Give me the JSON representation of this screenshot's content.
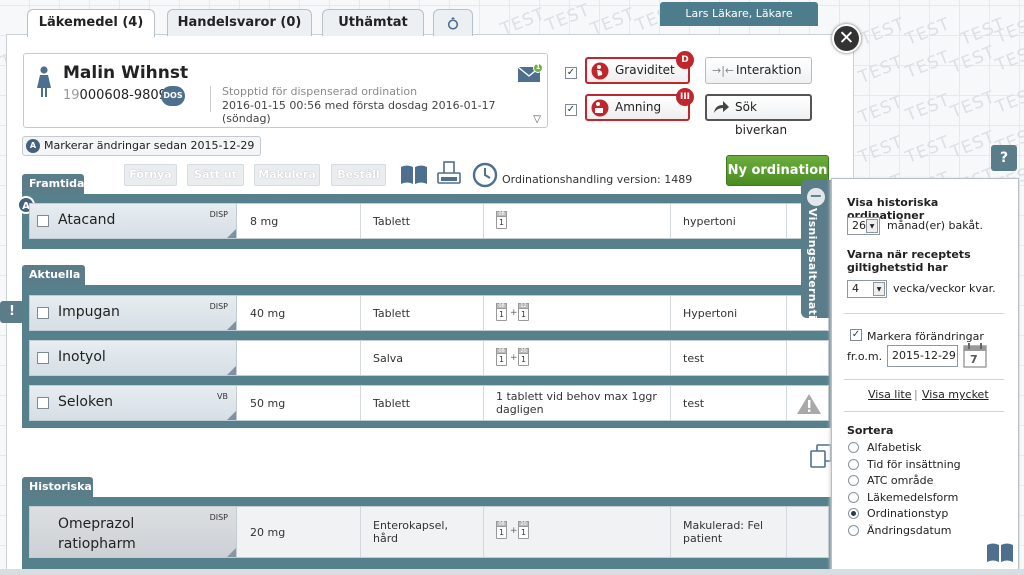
{
  "tabs": [
    {
      "label": "Läkemedel (4)"
    },
    {
      "label": "Handelsvaror (0)"
    },
    {
      "label": "Uthämtat"
    }
  ],
  "watermark": "TEST",
  "user": {
    "label": "Lars Läkare, Läkare"
  },
  "patient": {
    "name": "Malin Wihnst",
    "id_prefix": "19",
    "id_rest": "000608-9809",
    "dos_badge": "DOS",
    "stop_label": "Stopptid för dispenserad ordination",
    "stop_detail": "2016-01-15 00:56 med första dosdag 2016-01-17 (söndag)",
    "mail_badge": "1"
  },
  "flags": {
    "pregnancy": {
      "label": "Graviditet",
      "badge": "D",
      "checked": true
    },
    "breastfeeding": {
      "label": "Amning",
      "badge": "III",
      "checked": true
    }
  },
  "actions": {
    "interaction": "Interaktion",
    "side_effects": "Sök biverkan"
  },
  "changes": {
    "badge": "A",
    "label": "Markerar ändringar sedan 2015-12-29"
  },
  "toolbar": {
    "renew": "Förnya",
    "discontinue": "Sätt ut",
    "cancel": "Makulera",
    "order": "Beställ",
    "version": "Ordinationshandling version: 1489",
    "new_order": "Ny ordination"
  },
  "sections": {
    "future": "Framtida",
    "current": "Aktuella",
    "historical": "Historiska"
  },
  "rows": {
    "atacand": {
      "name": "Atacand",
      "tag": "DISP",
      "dose": "8 mg",
      "form": "Tablett",
      "boxes": [
        "1"
      ],
      "box_tops": [
        "08"
      ],
      "indication": "hypertoni",
      "marker": "A"
    },
    "impugan": {
      "name": "Impugan",
      "tag": "DISP",
      "dose": "40 mg",
      "form": "Tablett",
      "boxes": [
        "1",
        "1"
      ],
      "box_tops": [
        "08",
        "12"
      ],
      "indication": "Hypertoni"
    },
    "inotyol": {
      "name": "Inotyol",
      "tag": "",
      "dose": "",
      "form": "Salva",
      "boxes": [
        "1",
        "1"
      ],
      "box_tops": [
        "08",
        "20"
      ],
      "indication": "test"
    },
    "seloken": {
      "name": "Seloken",
      "tag": "VB",
      "dose": "50 mg",
      "form": "Tablett",
      "instruction": "1 tablett vid behov max 1ggr dagligen",
      "indication": "test"
    },
    "omeprazol": {
      "name": "Omeprazol ratiopharm",
      "tag": "DISP",
      "dose": "20 mg",
      "form": "Enterokapsel, hård",
      "boxes": [
        "1",
        "1"
      ],
      "box_tops": [
        "08",
        "20"
      ],
      "indication": "Makulerad: Fel patient"
    }
  },
  "side_tab": {
    "label": "Visningsalternativ",
    "help": "?"
  },
  "panel": {
    "history_title": "Visa historiska ordinationer",
    "history_value": "26",
    "history_suffix": "månad(er) bakåt.",
    "warn_title": "Varna när receptets giltighetstid har",
    "warn_value": "4",
    "warn_suffix": "vecka/veckor kvar.",
    "mark_label": "Markera förändringar",
    "from_label": "fr.o.m.",
    "from_value": "2015-12-29",
    "calendar_day": "7",
    "show_less": "Visa lite",
    "separator": "|",
    "show_more": "Visa mycket",
    "sort_title": "Sortera",
    "sort_options": [
      "Alfabetisk",
      "Tid för insättning",
      "ATC område",
      "Läkemedelsform",
      "Ordinationstyp",
      "Ändringsdatum"
    ],
    "sort_selected_index": 4
  },
  "colors": {
    "section": "#5b7d8a",
    "danger": "#c0272d",
    "new_order": "#4a8c23",
    "user_bar": "#4d7d8c"
  }
}
